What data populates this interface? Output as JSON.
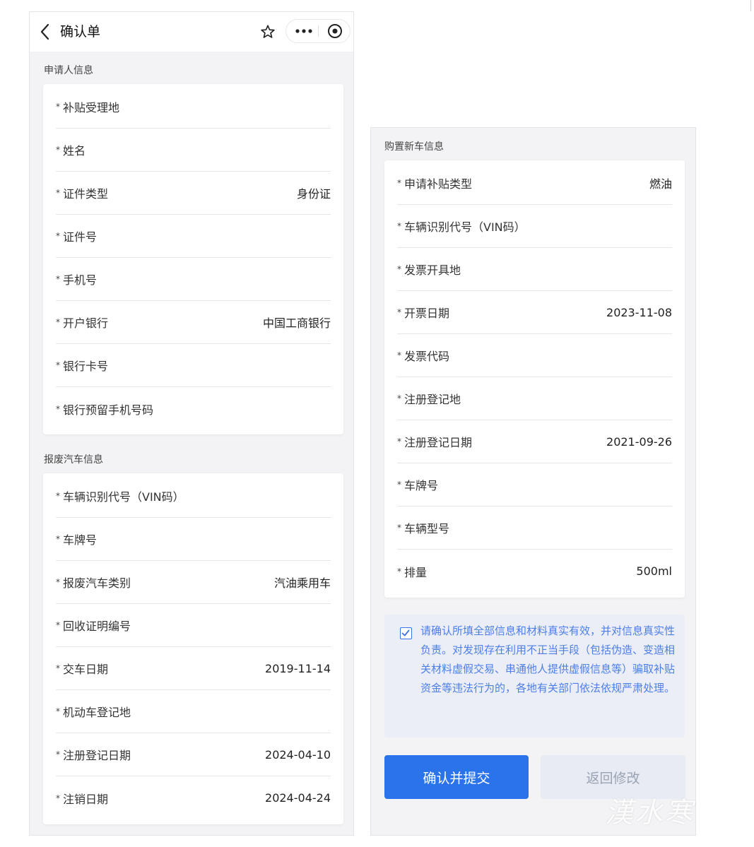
{
  "nav": {
    "title": "确认单"
  },
  "applicant": {
    "title": "申请人信息",
    "rows": [
      {
        "label": "补贴受理地",
        "value": ""
      },
      {
        "label": "姓名",
        "value": ""
      },
      {
        "label": "证件类型",
        "value": "身份证"
      },
      {
        "label": "证件号",
        "value": ""
      },
      {
        "label": "手机号",
        "value": ""
      },
      {
        "label": "开户银行",
        "value": "中国工商银行"
      },
      {
        "label": "银行卡号",
        "value": ""
      },
      {
        "label": "银行预留手机号码",
        "value": ""
      }
    ]
  },
  "scrap": {
    "title": "报废汽车信息",
    "rows": [
      {
        "label": "车辆识别代号（VIN码）",
        "value": ""
      },
      {
        "label": "车牌号",
        "value": ""
      },
      {
        "label": "报废汽车类别",
        "value": "汽油乘用车"
      },
      {
        "label": "回收证明编号",
        "value": ""
      },
      {
        "label": "交车日期",
        "value": "2019-11-14"
      },
      {
        "label": "机动车登记地",
        "value": ""
      },
      {
        "label": "注册登记日期",
        "value": "2024-04-10"
      },
      {
        "label": "注销日期",
        "value": "2024-04-24"
      }
    ]
  },
  "newcar": {
    "title": "购置新车信息",
    "rows": [
      {
        "label": "申请补贴类型",
        "value": "燃油"
      },
      {
        "label": "车辆识别代号（VIN码）",
        "value": ""
      },
      {
        "label": "发票开具地",
        "value": ""
      },
      {
        "label": "开票日期",
        "value": "2023-11-08"
      },
      {
        "label": "发票代码",
        "value": ""
      },
      {
        "label": "注册登记地",
        "value": ""
      },
      {
        "label": "注册登记日期",
        "value": "2021-09-26"
      },
      {
        "label": "车牌号",
        "value": ""
      },
      {
        "label": "车辆型号",
        "value": ""
      },
      {
        "label": "排量",
        "value": "500ml"
      }
    ]
  },
  "notice": {
    "checked": true,
    "text": "请确认所填全部信息和材料真实有效，并对信息真实性负责。对发现存在利用不正当手段（包括伪造、变造相关材料虚假交易、串通他人提供虚假信息等）骗取补贴资金等违法行为的，各地有关部门依法依规严肃处理。"
  },
  "buttons": {
    "confirm": "确认并提交",
    "back": "返回修改"
  },
  "colors": {
    "primary": "#2b73ea",
    "notice_text": "#4d7ee8",
    "notice_bg": "#ebeef7"
  },
  "icons": [
    "back-arrow-icon",
    "star-icon",
    "more-dots-icon",
    "target-circle-icon",
    "checkmark-icon"
  ],
  "watermark": "漢水寒"
}
